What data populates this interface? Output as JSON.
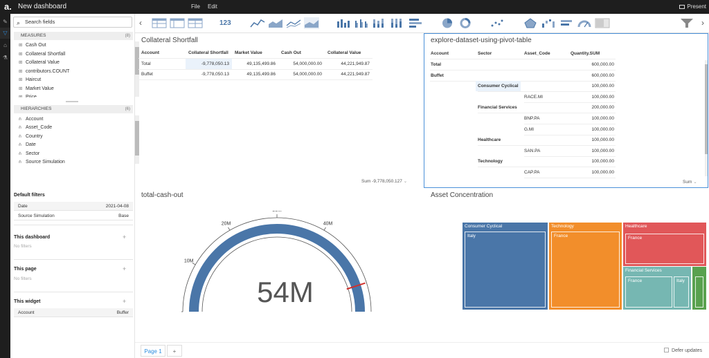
{
  "app": {
    "logo": "a.",
    "title": "New dashboard",
    "menu": [
      "File",
      "Edit"
    ],
    "present_label": "Present"
  },
  "sidebar": {
    "search_placeholder": "Search fields",
    "measures_label": "MEASURES",
    "measures_count": "(8)",
    "measures": [
      "Cash Out",
      "Collateral Shortfall",
      "Collateral Value",
      "contributors.COUNT",
      "Haircut",
      "Market Value",
      "Price"
    ],
    "hierarchies_label": "HIERARCHIES",
    "hierarchies_count": "(6)",
    "hierarchies": [
      "Account",
      "Asset_Code",
      "Country",
      "Date",
      "Sector",
      "Source Simulation"
    ],
    "default_filters_label": "Default filters",
    "default_filters": [
      {
        "name": "Date",
        "value": "2021-04-08"
      },
      {
        "name": "Source Simulation",
        "value": "Base"
      }
    ],
    "this_dashboard_label": "This dashboard",
    "this_page_label": "This page",
    "no_filters": "No filters",
    "this_widget_label": "This widget",
    "widget_filters": [
      {
        "name": "Account",
        "value": "Buffer"
      }
    ]
  },
  "collateral_table": {
    "title": "Collateral Shortfall",
    "headers": [
      "Account",
      "Collateral Shortfall",
      "Market Value",
      "Cash Out",
      "Collateral Value"
    ],
    "rows": [
      [
        "Total",
        "-9,778,050.13",
        "49,135,499.86",
        "54,000,000.00",
        "44,221,949.87"
      ],
      [
        "Buffet",
        "-9,778,050.13",
        "49,135,499.86",
        "54,000,000.00",
        "44,221,949.87"
      ]
    ],
    "footer": "Sum -9,778,050.127"
  },
  "pivot": {
    "title": "explore-dataset-using-pivot-table",
    "headers": [
      "Account",
      "Sector",
      "Asset_Code",
      "Quantity.SUM"
    ],
    "rows": [
      {
        "level": 0,
        "label": "Total",
        "value": "600,000.00"
      },
      {
        "level": 0,
        "label": "Buffet",
        "value": "600,000.00"
      },
      {
        "level": 1,
        "label": "Consumer Cyclical",
        "value": "100,000.00"
      },
      {
        "level": 2,
        "label": "RACE.MI",
        "value": "100,000.00"
      },
      {
        "level": 1,
        "label": "Financial Services",
        "value": "200,000.00"
      },
      {
        "level": 2,
        "label": "BNP.PA",
        "value": "100,000.00"
      },
      {
        "level": 2,
        "label": "G.MI",
        "value": "100,000.00"
      },
      {
        "level": 1,
        "label": "Healthcare",
        "value": "100,000.00"
      },
      {
        "level": 2,
        "label": "SAN.PA",
        "value": "100,000.00"
      },
      {
        "level": 1,
        "label": "Technology",
        "value": "100,000.00"
      },
      {
        "level": 2,
        "label": "CAP.PA",
        "value": "100,000.00"
      }
    ],
    "footer": "Sum"
  },
  "gauge": {
    "title": "total-cash-out",
    "value_label": "54M",
    "value": 54000000,
    "max": 60000000,
    "ticks": [
      "0",
      "10M",
      "20M",
      "30M",
      "40M"
    ],
    "tick_values": [
      0,
      10000000,
      20000000,
      30000000,
      40000000
    ],
    "bar_color": "#4a76a8",
    "needle_color": "#d0312d"
  },
  "treemap": {
    "title": "Asset Concentration",
    "sectors": [
      {
        "name": "Consumer Cyclical",
        "color": "#4a76a8",
        "children": [
          "Italy"
        ]
      },
      {
        "name": "Technology",
        "color": "#f28e2b",
        "children": [
          "France"
        ]
      },
      {
        "name": "Healthcare",
        "color": "#e15759",
        "children": [
          "France"
        ]
      },
      {
        "name": "Financial Services",
        "color": "#76b7b2",
        "children": [
          "France",
          "Italy"
        ]
      },
      {
        "name": "",
        "color": "#59a14f",
        "children": [
          ""
        ]
      }
    ]
  },
  "pages": {
    "tabs": [
      "Page 1"
    ],
    "add_label": "+",
    "defer_label": "Defer updates"
  }
}
